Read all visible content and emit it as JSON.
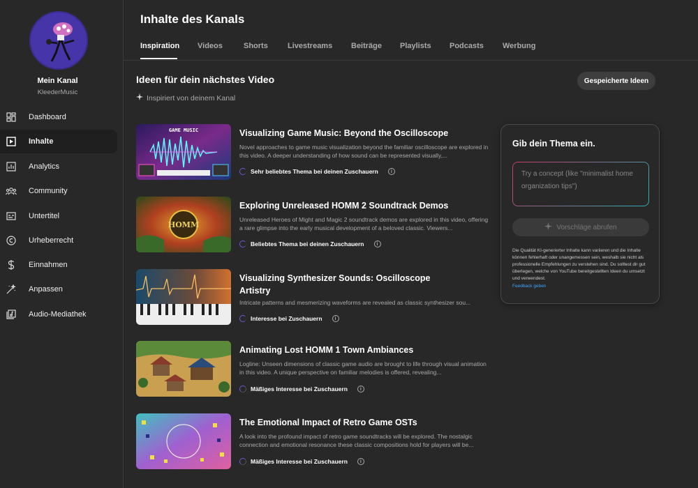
{
  "channel": {
    "name": "Mein Kanal",
    "handle": "KleederMusic"
  },
  "sidebar": {
    "items": [
      {
        "label": "Dashboard",
        "icon": "dashboard-icon"
      },
      {
        "label": "Inhalte",
        "icon": "content-icon",
        "active": true
      },
      {
        "label": "Analytics",
        "icon": "analytics-icon"
      },
      {
        "label": "Community",
        "icon": "community-icon"
      },
      {
        "label": "Untertitel",
        "icon": "subtitles-icon"
      },
      {
        "label": "Urheberrecht",
        "icon": "copyright-icon"
      },
      {
        "label": "Einnahmen",
        "icon": "dollar-icon"
      },
      {
        "label": "Anpassen",
        "icon": "magic-wand-icon"
      },
      {
        "label": "Audio-Mediathek",
        "icon": "audio-library-icon"
      }
    ]
  },
  "header": {
    "title": "Inhalte des Kanals",
    "tabs": [
      "Inspiration",
      "Videos",
      "Shorts",
      "Livestreams",
      "Beiträge",
      "Playlists",
      "Podcasts",
      "Werbung"
    ],
    "active_tab": "Inspiration"
  },
  "main": {
    "section_title": "Ideen für dein nächstes Video",
    "inspired_label": "Inspiriert von deinem Kanal",
    "saved_ideas_label": "Gespeicherte Ideen",
    "ideas": [
      {
        "title": "Visualizing Game Music: Beyond the Oscilloscope",
        "description": "Novel approaches to game music visualization beyond the familiar oscilloscope are explored in this video. A deeper understanding of how sound can be represented visually,...",
        "status": "Sehr beliebtes Thema bei deinen Zuschauern",
        "thumb_text": "GAME MUSIC"
      },
      {
        "title": "Exploring Unreleased HOMM 2 Soundtrack Demos",
        "description": "Unreleased Heroes of Might and Magic 2 soundtrack demos are explored in this video, offering a rare glimpse into the early musical development of a beloved classic. Viewers...",
        "status": "Beliebtes Thema bei deinen Zuschauern",
        "thumb_text": "HOMM"
      },
      {
        "title": "Visualizing Synthesizer Sounds: Oscilloscope Artistry",
        "description": "Intricate patterns and mesmerizing waveforms are revealed as classic synthesizer sou...",
        "status": "Interesse bei Zuschauern",
        "thumb_text": ""
      },
      {
        "title": "Animating Lost HOMM 1 Town Ambiances",
        "description": "Logline: Unseen dimensions of classic game audio are brought to life through visual animation in this video. A unique perspective on familiar melodies is offered, revealing...",
        "status": "Mäßiges Interesse bei Zuschauern",
        "thumb_text": ""
      },
      {
        "title": "The Emotional Impact of Retro Game OSTs",
        "description": "A look into the profound impact of retro game soundtracks will be explored. The nostalgic connection and emotional resonance these classic compositions hold for players will be...",
        "status": "Mäßiges Interesse bei Zuschauern",
        "thumb_text": ""
      }
    ]
  },
  "panel": {
    "title": "Gib dein Thema ein.",
    "input_placeholder": "Try a concept (like \"minimalist home organization tips\")",
    "input_value": "",
    "suggest_label": "Vorschläge abrufen",
    "disclaimer": "Die Qualität KI-generierter Inhalte kann variieren und die Inhalte können fehlerhaft oder unangemessen sein, weshalb sie nicht als professionelle Empfehlungen zu verstehen sind. Du solltest dir gut überlegen, welche von YouTube bereitgestellten Ideen du umsetzt und verwendest.",
    "feedback_label": "Feedback geben"
  },
  "colors": {
    "background": "#282828",
    "accent_link": "#3ea6ff",
    "spinner": "#6a5cd8"
  }
}
